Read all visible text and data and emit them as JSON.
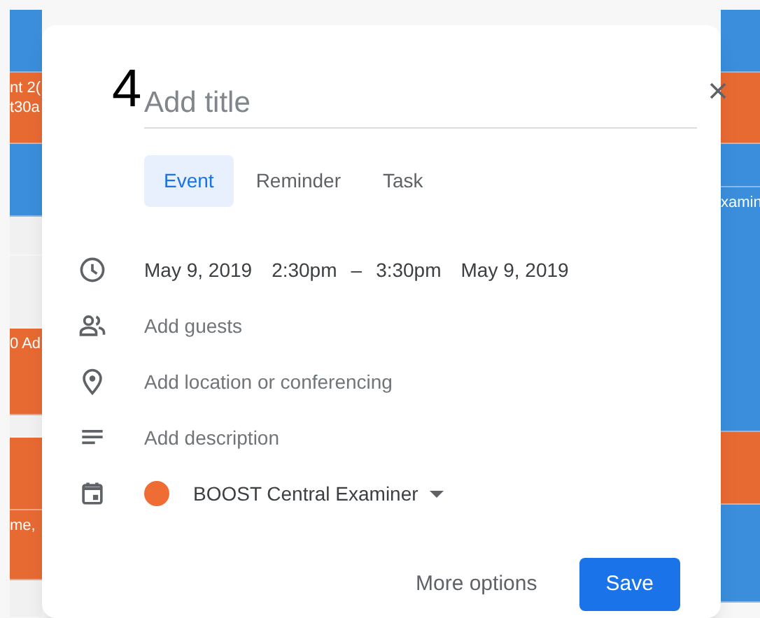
{
  "calendar_left": [
    {
      "color": "#3a8edb"
    },
    {
      "color": "#e86a33",
      "lines": [
        "nt 2(",
        "t30a"
      ]
    },
    {
      "color": "#3a8edb"
    },
    {
      "color": "#f1f1f1"
    },
    {
      "color": "#f1f1f1"
    },
    {
      "color": "#e86a33",
      "lines": [
        "0 Ad"
      ]
    },
    {
      "color": "#f1f1f1"
    },
    {
      "color": "#e86a33"
    },
    {
      "color": "#e86a33",
      "lines": [
        "me,"
      ]
    },
    {
      "color": "#f1f1f1"
    }
  ],
  "calendar_right": [
    {
      "color": "#3a8edb"
    },
    {
      "color": "#e86a33"
    },
    {
      "color": "#3a8edb"
    },
    {
      "color": "#3a8edb",
      "lines": [
        "xamin"
      ]
    },
    {
      "color": "#e86a33"
    },
    {
      "color": "#3a8edb"
    }
  ],
  "dialog": {
    "step_number": "4",
    "title": {
      "placeholder": "Add title"
    },
    "tabs": [
      {
        "label": "Event",
        "selected": true
      },
      {
        "label": "Reminder",
        "selected": false
      },
      {
        "label": "Task",
        "selected": false
      }
    ],
    "rows": [
      {
        "kind": "time",
        "date_start": "May 9, 2019",
        "time_start": "2:30pm",
        "separator": "–",
        "time_end": "3:30pm",
        "date_end": "May 9, 2019"
      },
      {
        "kind": "guests",
        "text": "Add guests"
      },
      {
        "kind": "location",
        "text": "Add location or conferencing"
      },
      {
        "kind": "description",
        "text": "Add description"
      },
      {
        "kind": "calendar",
        "text": "BOOST Central Examiner",
        "color": "#ef6c35"
      }
    ],
    "buttons": [
      "More options",
      "Save"
    ]
  }
}
